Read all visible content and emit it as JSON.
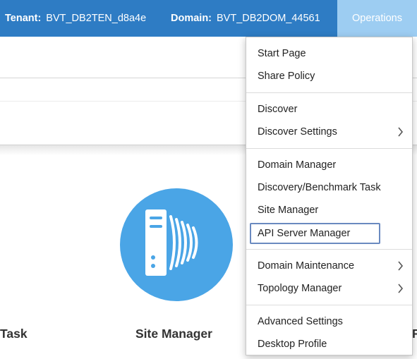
{
  "header": {
    "tenant_label": "Tenant:",
    "tenant_value": "BVT_DB2TEN_d8a4e",
    "domain_label": "Domain:",
    "domain_value": "BVT_DB2DOM_44561",
    "operations_label": "Operations"
  },
  "tiles": {
    "left_label": "Task",
    "center_label": "Site Manager",
    "right_label": "P"
  },
  "menu": {
    "groups": [
      [
        {
          "label": "Start Page",
          "submenu": false
        },
        {
          "label": "Share Policy",
          "submenu": false
        }
      ],
      [
        {
          "label": "Discover",
          "submenu": false
        },
        {
          "label": "Discover Settings",
          "submenu": true
        }
      ],
      [
        {
          "label": "Domain Manager",
          "submenu": false
        },
        {
          "label": "Discovery/Benchmark Task",
          "submenu": false
        },
        {
          "label": "Site Manager",
          "submenu": false
        },
        {
          "label": "API Server Manager",
          "submenu": false,
          "focused": true
        }
      ],
      [
        {
          "label": "Domain Maintenance",
          "submenu": true
        },
        {
          "label": "Topology Manager",
          "submenu": true
        }
      ],
      [
        {
          "label": "Advanced Settings",
          "submenu": false
        },
        {
          "label": "Desktop Profile",
          "submenu": false
        }
      ]
    ]
  },
  "colors": {
    "header_bg": "#2e7cc4",
    "operations_bg": "#9dcdf2",
    "tile_circle": "#4aa5e6",
    "focus_border": "#6a8ac0"
  },
  "icons": {
    "site_manager_tile": "server-signal-icon",
    "submenu_arrow": "chevron-right-icon"
  }
}
